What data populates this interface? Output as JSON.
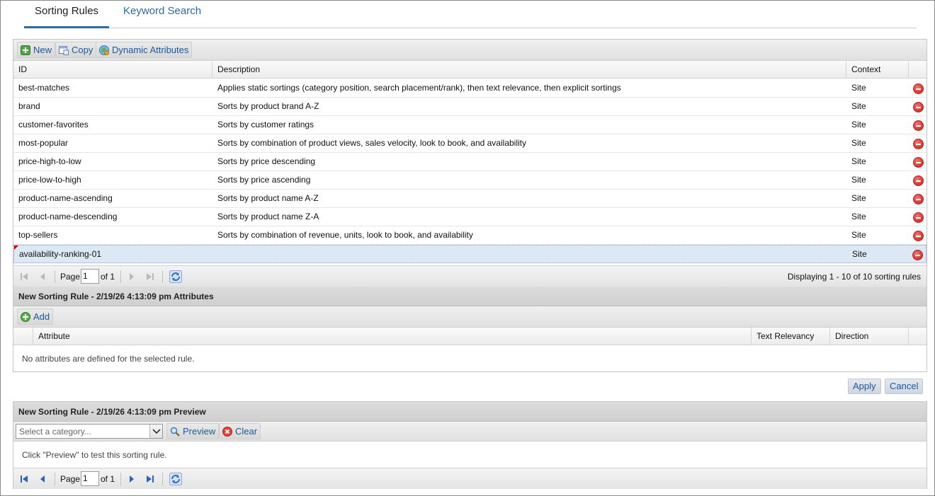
{
  "tabs": [
    {
      "label": "Sorting Rules",
      "active": true
    },
    {
      "label": "Keyword Search",
      "active": false
    }
  ],
  "rules_toolbar": {
    "new_label": "New",
    "copy_label": "Copy",
    "dynamic_label": "Dynamic Attributes"
  },
  "rules_grid": {
    "columns": [
      "ID",
      "Description",
      "Context"
    ],
    "rows": [
      {
        "id": "best-matches",
        "description": "Applies static sortings (category position, search placement/rank), then text relevance, then explicit sortings",
        "context": "Site"
      },
      {
        "id": "brand",
        "description": "Sorts by product brand A-Z",
        "context": "Site"
      },
      {
        "id": "customer-favorites",
        "description": "Sorts by customer ratings",
        "context": "Site"
      },
      {
        "id": "most-popular",
        "description": "Sorts by combination of product views, sales velocity, look to book, and availability",
        "context": "Site"
      },
      {
        "id": "price-high-to-low",
        "description": "Sorts by price descending",
        "context": "Site"
      },
      {
        "id": "price-low-to-high",
        "description": "Sorts by price ascending",
        "context": "Site"
      },
      {
        "id": "product-name-ascending",
        "description": "Sorts by product name A-Z",
        "context": "Site"
      },
      {
        "id": "product-name-descending",
        "description": "Sorts by product name Z-A",
        "context": "Site"
      },
      {
        "id": "top-sellers",
        "description": "Sorts by combination of revenue, units, look to book, and availability",
        "context": "Site"
      },
      {
        "id": "availability-ranking-01",
        "description": "",
        "context": "Site",
        "selected": true
      }
    ]
  },
  "rules_pager": {
    "page_label": "Page",
    "page_value": "1",
    "of_label": "of 1",
    "display_text": "Displaying 1 - 10 of 10 sorting rules"
  },
  "attributes": {
    "title": "New Sorting Rule - 2/19/26 4:13:09 pm Attributes",
    "add_label": "Add",
    "columns": [
      "Attribute",
      "Text Relevancy",
      "Direction"
    ],
    "empty_text": "No attributes are defined for the selected rule."
  },
  "actions": {
    "apply_label": "Apply",
    "cancel_label": "Cancel"
  },
  "preview": {
    "title": "New Sorting Rule - 2/19/26 4:13:09 pm Preview",
    "category_placeholder": "Select a category...",
    "preview_label": "Preview",
    "clear_label": "Clear",
    "hint_text": "Click \"Preview\" to test this sorting rule.",
    "page_label": "Page",
    "page_value": "1",
    "of_label": "of 1"
  },
  "colors": {
    "link_blue": "#1a5aa0",
    "selected_row": "#dde8f5",
    "delete_red": "#d7322b",
    "tab_underline": "#2f6aa7"
  }
}
